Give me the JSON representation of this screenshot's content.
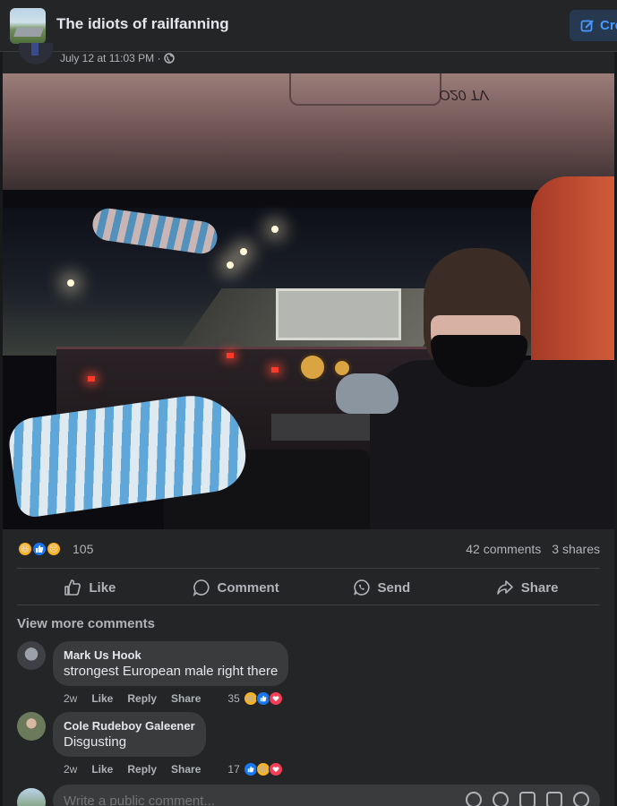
{
  "group": {
    "name": "The idiots of railfanning",
    "create_label": "Cre"
  },
  "post": {
    "timestamp": "July 12 at 11:03 PM ·",
    "privacy_icon": "globe-icon",
    "photo_caption_text": "O20 TV",
    "reactions": {
      "types": [
        "haha",
        "like",
        "sad"
      ],
      "count": "105"
    },
    "comments_count": "42 comments",
    "shares_count": "3 shares",
    "actions": {
      "like": "Like",
      "comment": "Comment",
      "send": "Send",
      "share": "Share"
    }
  },
  "comments_section": {
    "view_more": "View more comments",
    "comments": [
      {
        "author": "Mark Us Hook",
        "text": "strongest European male right there",
        "time": "2w",
        "like": "Like",
        "reply": "Reply",
        "share": "Share",
        "reaction_count": "35",
        "reaction_types": [
          "haha",
          "like",
          "love"
        ]
      },
      {
        "author": "Cole Rudeboy Galeener",
        "text": "Disgusting",
        "time": "2w",
        "like": "Like",
        "reply": "Reply",
        "share": "Share",
        "reaction_count": "17",
        "reaction_types": [
          "like",
          "haha",
          "love"
        ]
      }
    ],
    "write_placeholder": "Write a public comment..."
  },
  "colors": {
    "background": "#18191a",
    "surface": "#242526",
    "bubble": "#3a3b3c",
    "accent": "#1877f2",
    "text_primary": "#e4e6eb",
    "text_secondary": "#b0b3b8"
  }
}
